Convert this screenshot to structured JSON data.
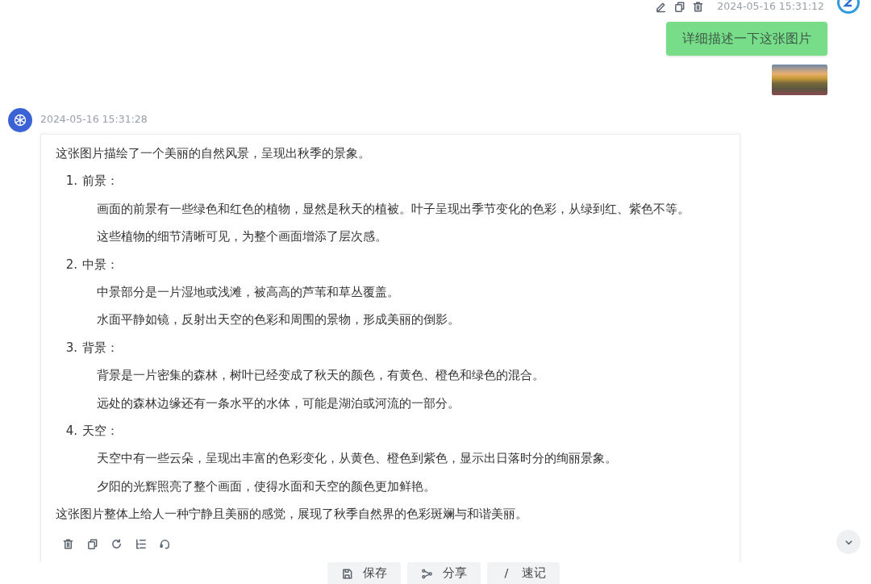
{
  "user_message": {
    "timestamp": "2024-05-16 15:31:12",
    "text": "详细描述一下这张图片"
  },
  "assistant_message": {
    "timestamp": "2024-05-16 15:31:28",
    "intro": "这张图片描绘了一个美丽的自然风景，呈现出秋季的景象。",
    "sections": [
      {
        "number": "1.",
        "title": "前景：",
        "lines": [
          "画面的前景有一些绿色和红色的植物，显然是秋天的植被。叶子呈现出季节变化的色彩，从绿到红、紫色不等。",
          "这些植物的细节清晰可见，为整个画面增添了层次感。"
        ]
      },
      {
        "number": "2.",
        "title": "中景：",
        "lines": [
          "中景部分是一片湿地或浅滩，被高高的芦苇和草丛覆盖。",
          "水面平静如镜，反射出天空的色彩和周围的景物，形成美丽的倒影。"
        ]
      },
      {
        "number": "3.",
        "title": "背景：",
        "lines": [
          "背景是一片密集的森林，树叶已经变成了秋天的颜色，有黄色、橙色和绿色的混合。",
          "远处的森林边缘还有一条水平的水体，可能是湖泊或河流的一部分。"
        ]
      },
      {
        "number": "4.",
        "title": "天空：",
        "lines": [
          "天空中有一些云朵，呈现出丰富的色彩变化，从黄色、橙色到紫色，显示出日落时分的绚丽景象。",
          "夕阳的光辉照亮了整个画面，使得水面和天空的颜色更加鲜艳。"
        ]
      }
    ],
    "conclusion": "这张图片整体上给人一种宁静且美丽的感觉，展现了秋季自然界的色彩斑斓与和谐美丽。"
  },
  "bottom_buttons": [
    {
      "kind": "save",
      "label": "保存"
    },
    {
      "kind": "share",
      "label": "分享"
    },
    {
      "kind": "shortcut",
      "glyph": "/",
      "label": "速记"
    }
  ]
}
